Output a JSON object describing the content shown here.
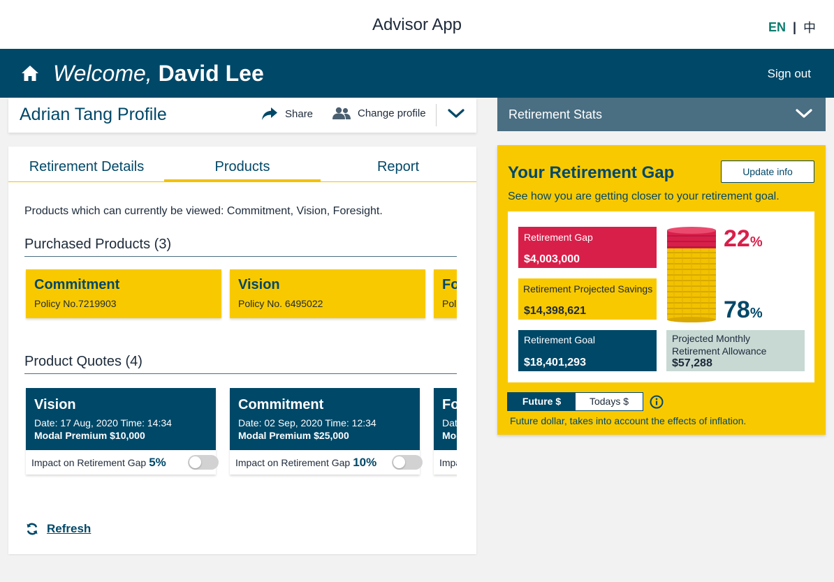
{
  "header": {
    "app_title": "Advisor App",
    "lang_en": "EN",
    "lang_sep": "|",
    "lang_zh": "中"
  },
  "welcome": {
    "greeting": "Welcome,",
    "name": "David Lee",
    "signout": "Sign out",
    "home_icon": "home-icon"
  },
  "profile": {
    "title": "Adrian Tang Profile",
    "share": "Share",
    "change_profile": "Change profile"
  },
  "stats": {
    "title": "Retirement Stats"
  },
  "tabs": [
    {
      "label": "Retirement Details",
      "active": false
    },
    {
      "label": "Products",
      "active": true
    },
    {
      "label": "Report",
      "active": false
    }
  ],
  "products": {
    "viewable_text": "Products which can currently be viewed: Commitment, Vision, Foresight.",
    "purchased_title": "Purchased Products (3)",
    "purchased": [
      {
        "name": "Commitment",
        "policy": "Policy No.7219903"
      },
      {
        "name": "Vision",
        "policy": "Policy No. 6495022"
      },
      {
        "name": "Foresight",
        "policy": "Policy No."
      }
    ],
    "quotes_title": "Product Quotes (4)",
    "quotes": [
      {
        "name": "Vision",
        "date": "Date: 17 Aug, 2020  Time: 14:34",
        "premium": "Modal Premium $10,000",
        "impact_label": "Impact on Retirement Gap",
        "impact_value": "5%"
      },
      {
        "name": "Commitment",
        "date": "Date: 02 Sep, 2020  Time: 12:34",
        "premium": "Modal Premium $25,000",
        "impact_label": "Impact on Retirement Gap",
        "impact_value": "10%"
      },
      {
        "name": "Foresight",
        "date": "Date",
        "premium": "Modal",
        "impact_label": "Impact on Retirement Gap",
        "impact_value": ""
      }
    ],
    "refresh": "Refresh"
  },
  "gap": {
    "title": "Your Retirement Gap",
    "update_button": "Update info",
    "subtitle": "See how you are getting closer to your retirement goal.",
    "retirement_gap_label": "Retirement Gap",
    "retirement_gap_value": "$4,003,000",
    "projected_savings_label": "Retirement Projected Savings",
    "projected_savings_value": "$14,398,621",
    "goal_label": "Retirement Goal",
    "goal_value": "$18,401,293",
    "allowance_label": "Projected Monthly Retirement Allowance",
    "allowance_value": "$57,288",
    "gap_pct": "22",
    "savings_pct": "78",
    "pct_symbol": "%",
    "toggle_future": "Future $",
    "toggle_today": "Todays $",
    "note": "Future dollar, takes into account the effects of inflation."
  },
  "colors": {
    "navy": "#004868",
    "yellow": "#f9c900",
    "red": "#d81f4a",
    "slate": "#4a6e82",
    "sage": "#c8d9d4"
  }
}
